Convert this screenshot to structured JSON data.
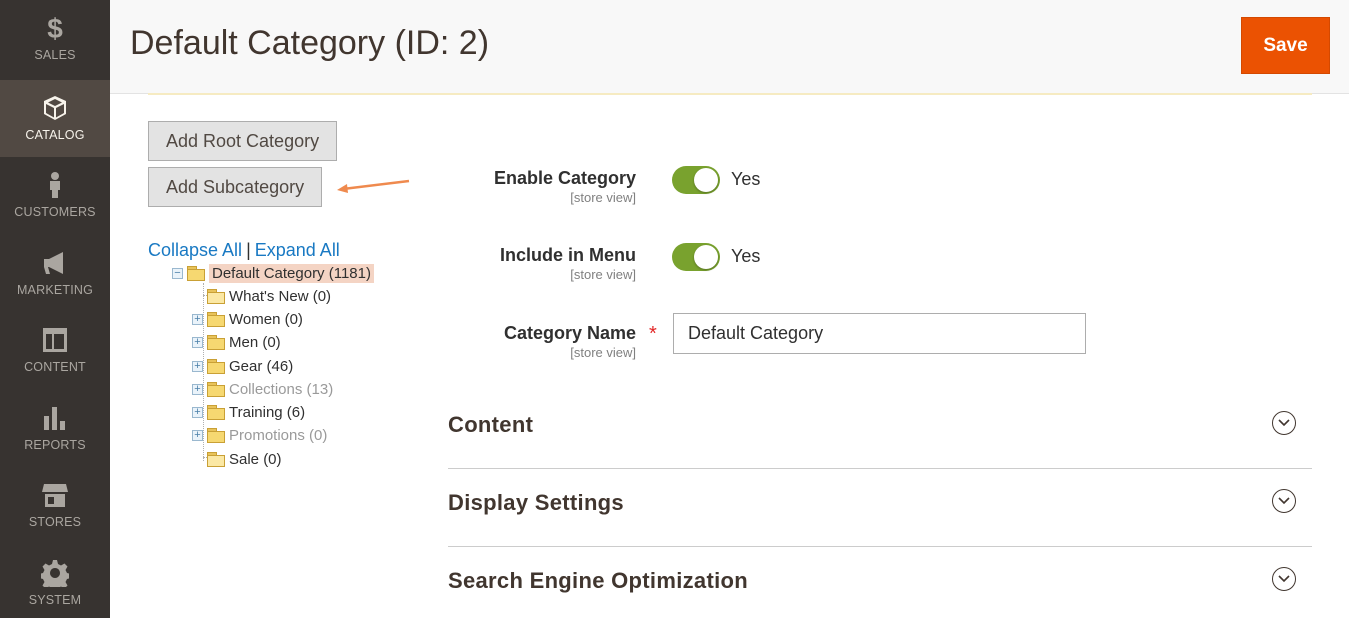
{
  "sidebar": {
    "items": [
      {
        "label": "SALES",
        "icon": "dollar-icon"
      },
      {
        "label": "CATALOG",
        "icon": "box-icon"
      },
      {
        "label": "CUSTOMERS",
        "icon": "person-icon"
      },
      {
        "label": "MARKETING",
        "icon": "megaphone-icon"
      },
      {
        "label": "CONTENT",
        "icon": "layout-icon"
      },
      {
        "label": "REPORTS",
        "icon": "bar-chart-icon"
      },
      {
        "label": "STORES",
        "icon": "storefront-icon"
      },
      {
        "label": "SYSTEM",
        "icon": "gear-icon"
      }
    ],
    "active": "CATALOG"
  },
  "header": {
    "title": "Default Category (ID: 2)",
    "save_label": "Save"
  },
  "actions": {
    "add_root": "Add Root Category",
    "add_sub": "Add Subcategory"
  },
  "tree": {
    "collapse_all": "Collapse All",
    "separator": "|",
    "expand_all": "Expand All",
    "root": "Default Category (1181)",
    "children": [
      {
        "label": "What's New (0)"
      },
      {
        "label": "Women (0)"
      },
      {
        "label": "Men (0)"
      },
      {
        "label": "Gear (46)"
      },
      {
        "label": "Collections (13)"
      },
      {
        "label": "Training (6)"
      },
      {
        "label": "Promotions (0)"
      },
      {
        "label": "Sale (0)"
      }
    ]
  },
  "form": {
    "enable": {
      "label": "Enable Category",
      "scope": "[store view]",
      "value": "Yes"
    },
    "menu": {
      "label": "Include in Menu",
      "scope": "[store view]",
      "value": "Yes"
    },
    "name": {
      "label": "Category Name",
      "scope": "[store view]",
      "required": "*",
      "value": "Default Category"
    }
  },
  "sections": [
    {
      "title": "Content"
    },
    {
      "title": "Display Settings"
    },
    {
      "title": "Search Engine Optimization"
    }
  ],
  "colors": {
    "accent": "#eb5202",
    "toggle_on": "#79a22e",
    "link": "#1979c3",
    "sidebar_bg": "#373330"
  }
}
